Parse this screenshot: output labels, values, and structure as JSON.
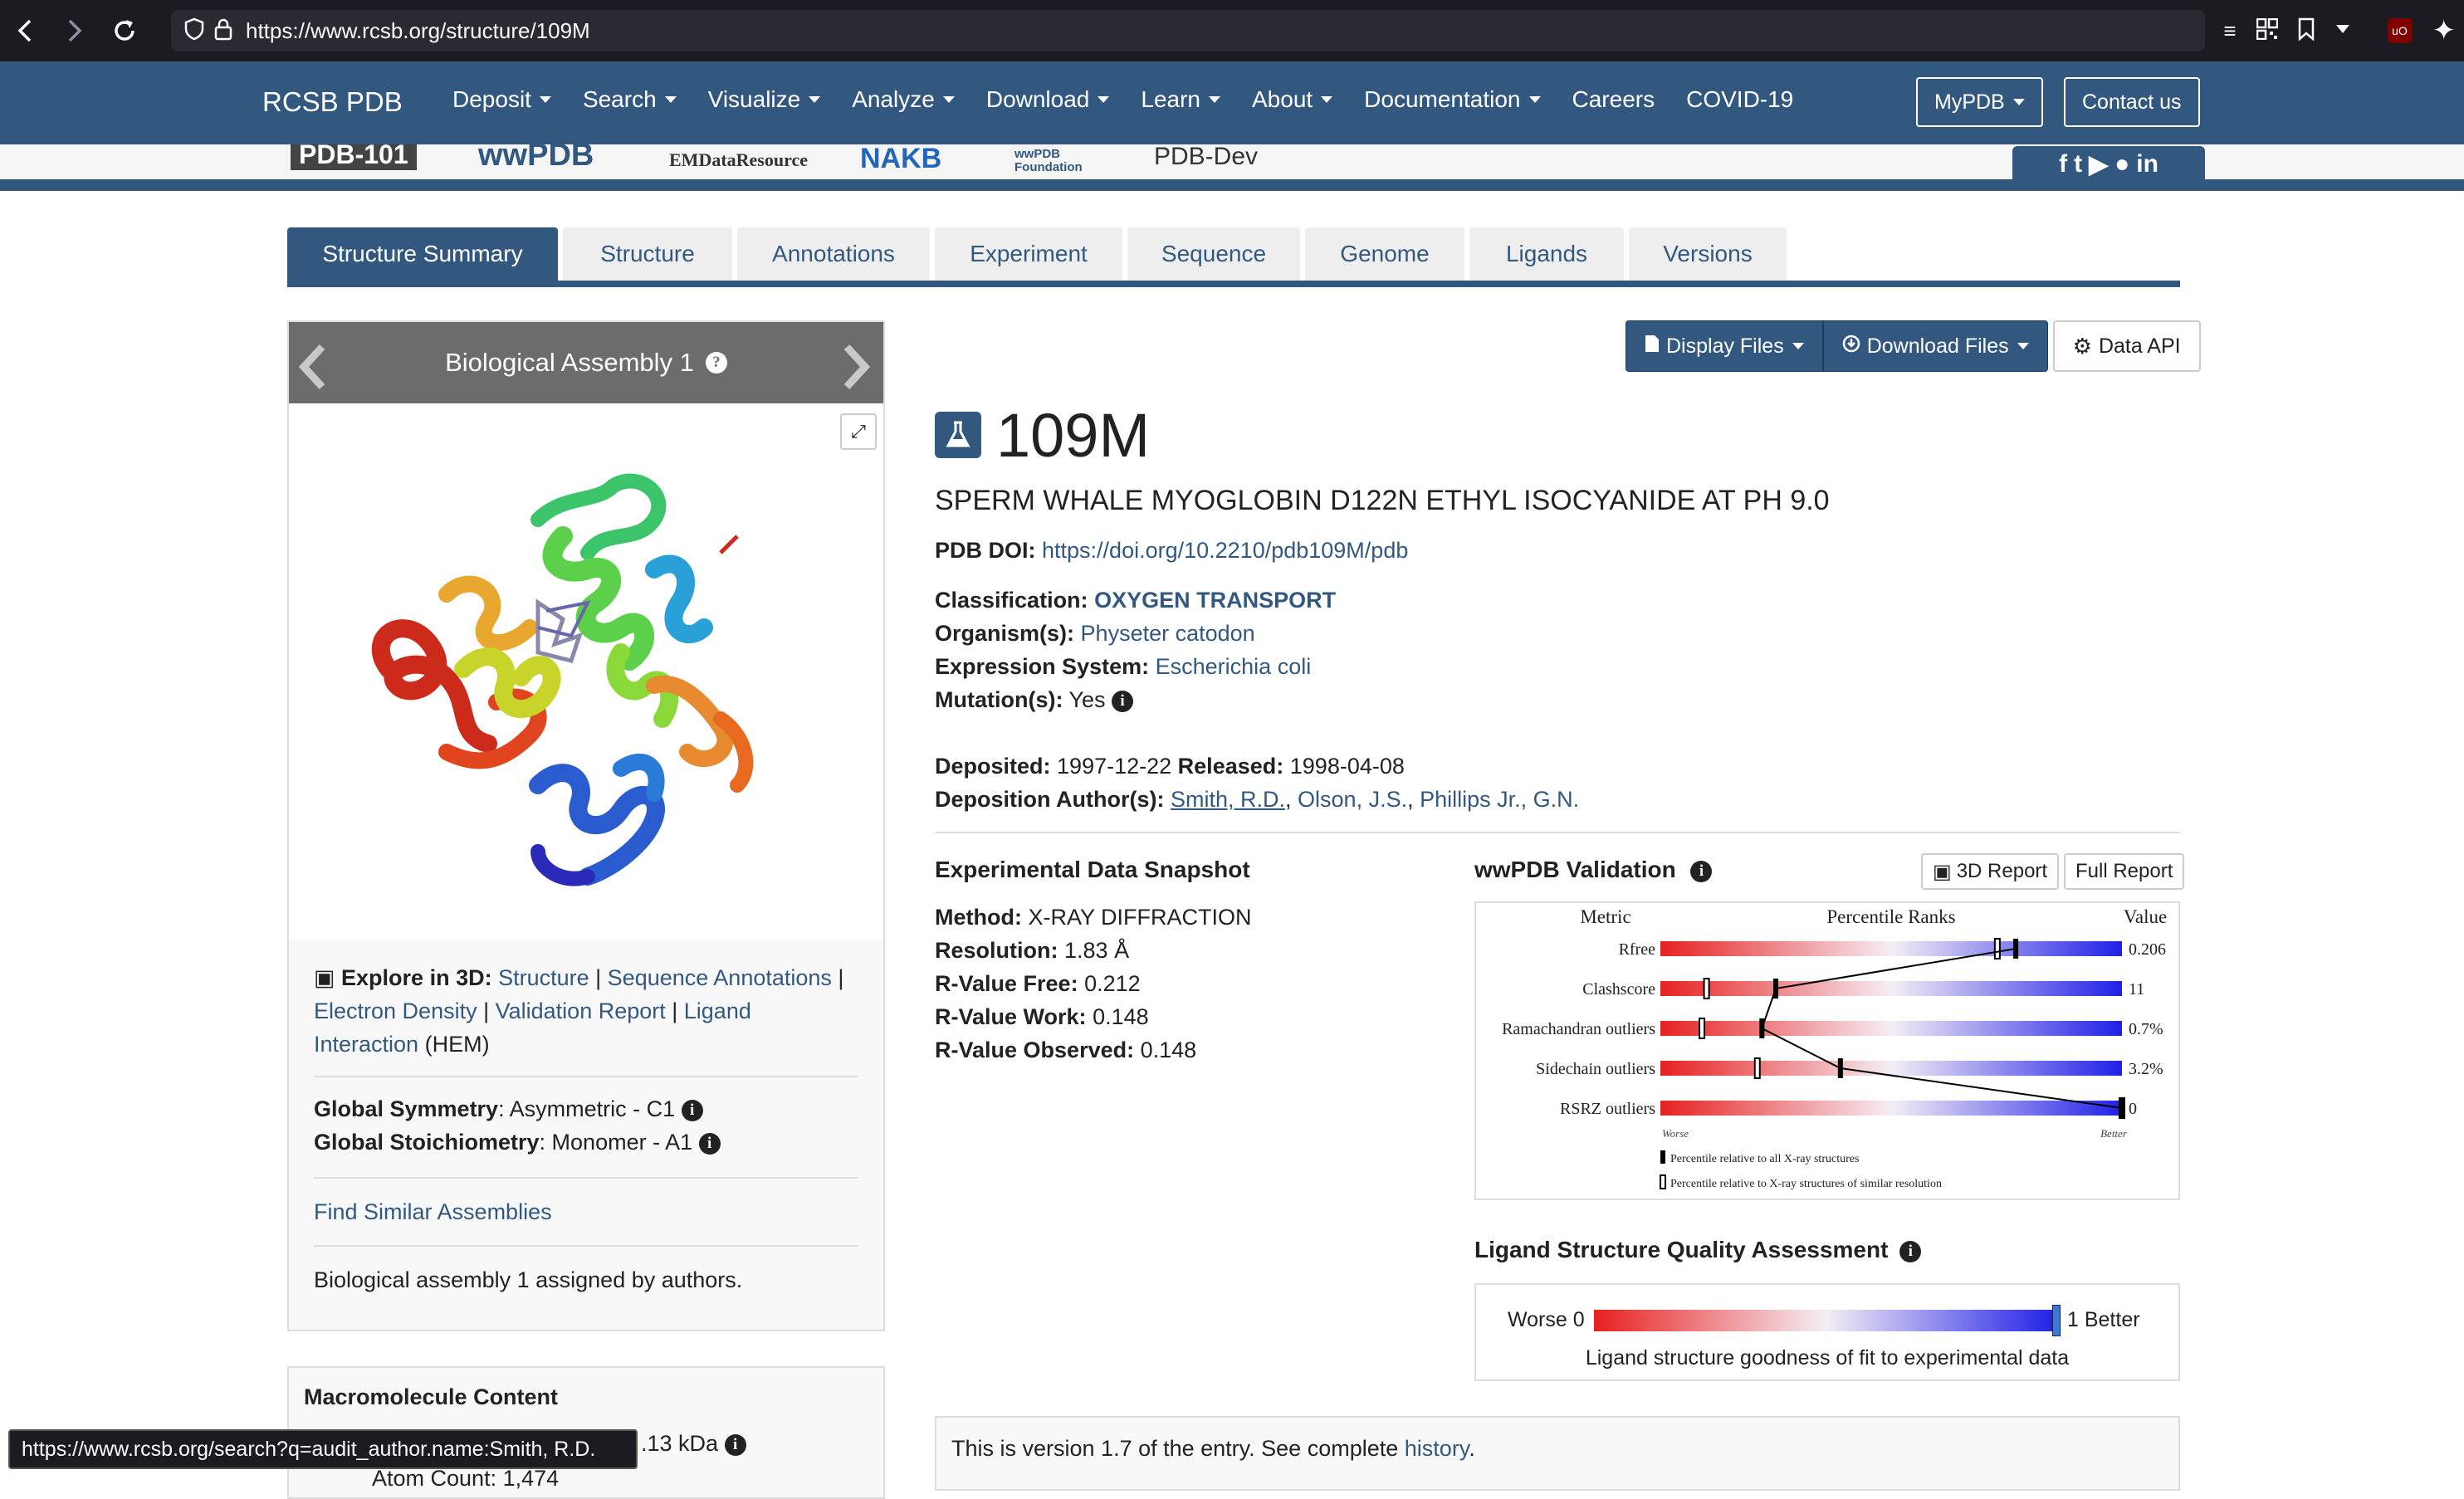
{
  "browser": {
    "url": "https://www.rcsb.org/structure/109M"
  },
  "nav": {
    "brand": "RCSB PDB",
    "menu": [
      "Deposit",
      "Search",
      "Visualize",
      "Analyze",
      "Download",
      "Learn",
      "About",
      "Documentation",
      "Careers",
      "COVID-19"
    ],
    "mypdb": "MyPDB",
    "contact": "Contact us"
  },
  "logos": [
    "PDB-101",
    "wwPDB",
    "EMDataResource",
    "NAKB",
    "wwPDB Foundation",
    "PDB-Dev"
  ],
  "tabs": [
    "Structure Summary",
    "Structure",
    "Annotations",
    "Experiment",
    "Sequence",
    "Genome",
    "Ligands",
    "Versions"
  ],
  "left": {
    "assembly_title": "Biological Assembly 1",
    "explore_label": "Explore in 3D",
    "explore_links": [
      "Structure",
      "Sequence Annotations",
      "Electron Density",
      "Validation Report",
      "Ligand Interaction"
    ],
    "ligand_code": "(HEM)",
    "global_symmetry_label": "Global Symmetry",
    "global_symmetry_value": ": Asymmetric - C1",
    "global_stoich_label": "Global Stoichiometry",
    "global_stoich_value": ": Monomer - A1",
    "find_similar": "Find Similar Assemblies",
    "assigned": "Biological assembly 1 assigned by authors.",
    "macro_title": "Macromolecule Content",
    "macro_weight": ".13 kDa",
    "macro_atoms": "Atom Count: 1,474"
  },
  "status_url": "https://www.rcsb.org/search?q=audit_author.name:Smith, R.D.",
  "actions": {
    "display_files": "Display Files",
    "download_files": "Download Files",
    "data_api": "Data API"
  },
  "entry": {
    "id": "109M",
    "title": "SPERM WHALE MYOGLOBIN D122N ETHYL ISOCYANIDE AT PH 9.0",
    "doi_label": "PDB DOI:",
    "doi": "https://doi.org/10.2210/pdb109M/pdb",
    "classification_label": "Classification:",
    "classification": "OXYGEN TRANSPORT",
    "organism_label": "Organism(s):",
    "organism": "Physeter catodon",
    "expression_label": "Expression System:",
    "expression": "Escherichia coli",
    "mutation_label": "Mutation(s):",
    "mutation": "Yes",
    "deposited_label": "Deposited:",
    "deposited": "1997-12-22",
    "released_label": "Released:",
    "released": "1998-04-08",
    "authors_label": "Deposition Author(s):",
    "authors": [
      "Smith, R.D.",
      "Olson, J.S.",
      "Phillips Jr., G.N."
    ]
  },
  "experimental": {
    "title": "Experimental Data Snapshot",
    "rows": [
      {
        "label": "Method:",
        "value": "X-RAY DIFFRACTION"
      },
      {
        "label": "Resolution:",
        "value": "1.83 Å"
      },
      {
        "label": "R-Value Free:",
        "value": "0.212"
      },
      {
        "label": "R-Value Work:",
        "value": "0.148"
      },
      {
        "label": "R-Value Observed:",
        "value": "0.148"
      }
    ]
  },
  "validation": {
    "title": "wwPDB Validation",
    "btn_3d": "3D Report",
    "btn_full": "Full Report",
    "col_metric": "Metric",
    "col_ranks": "Percentile Ranks",
    "col_value": "Value",
    "worse": "Worse",
    "better": "Better",
    "legend_all": "Percentile relative to all X-ray structures",
    "legend_similar": "Percentile relative to X-ray structures of similar resolution",
    "metrics": [
      {
        "name": "Rfree",
        "value": "0.206",
        "pct_all": 0.77,
        "pct_similar": 0.73
      },
      {
        "name": "Clashscore",
        "value": "11",
        "pct_all": 0.25,
        "pct_similar": 0.1
      },
      {
        "name": "Ramachandran outliers",
        "value": "0.7%",
        "pct_all": 0.22,
        "pct_similar": 0.09
      },
      {
        "name": "Sidechain outliers",
        "value": "3.2%",
        "pct_all": 0.39,
        "pct_similar": 0.21
      },
      {
        "name": "RSRZ outliers",
        "value": "0",
        "pct_all": 1.0,
        "pct_similar": 1.0
      }
    ]
  },
  "ligand_quality": {
    "title": "Ligand Structure Quality Assessment",
    "worse": "Worse 0",
    "better": "1 Better",
    "caption": "Ligand structure goodness of fit to experimental data",
    "marker_pct": 1.0
  },
  "version": {
    "text": "This is version 1.7 of the entry. See complete",
    "link": "history",
    "end": "."
  }
}
